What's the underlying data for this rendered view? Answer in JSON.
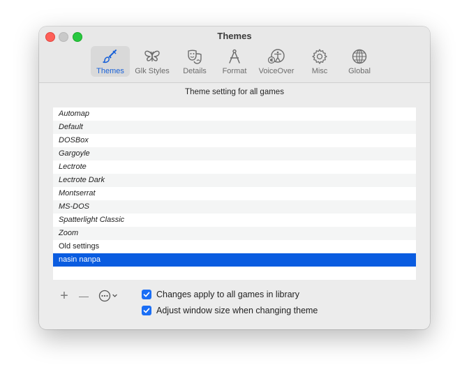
{
  "window": {
    "title": "Themes"
  },
  "tabs": [
    {
      "label": "Themes",
      "icon": "paintbrush-icon",
      "selected": true
    },
    {
      "label": "Glk Styles",
      "icon": "butterfly-icon",
      "selected": false
    },
    {
      "label": "Details",
      "icon": "theater-masks-icon",
      "selected": false
    },
    {
      "label": "Format",
      "icon": "compass-drafting-icon",
      "selected": false
    },
    {
      "label": "VoiceOver",
      "icon": "accessibility-speaker-icon",
      "selected": false
    },
    {
      "label": "Misc",
      "icon": "gear-icon",
      "selected": false
    },
    {
      "label": "Global",
      "icon": "globe-icon",
      "selected": false
    }
  ],
  "subtitle": "Theme setting for all games",
  "themes": [
    {
      "name": "Automap"
    },
    {
      "name": "Default"
    },
    {
      "name": "DOSBox"
    },
    {
      "name": "Gargoyle"
    },
    {
      "name": "Lectrote"
    },
    {
      "name": "Lectrote Dark"
    },
    {
      "name": "Montserrat"
    },
    {
      "name": "MS-DOS"
    },
    {
      "name": "Spatterlight Classic"
    },
    {
      "name": "Zoom"
    },
    {
      "name": "Old settings"
    },
    {
      "name": "nasin nanpa",
      "selected": true
    }
  ],
  "buttons": {
    "add": "+",
    "remove": "—"
  },
  "options": [
    {
      "label": "Changes apply to all games in library",
      "checked": true
    },
    {
      "label": "Adjust window size when changing theme",
      "checked": true
    }
  ],
  "colors": {
    "accent": "#0a5ce0",
    "close": "#fe5f57",
    "maximize": "#28c840"
  }
}
